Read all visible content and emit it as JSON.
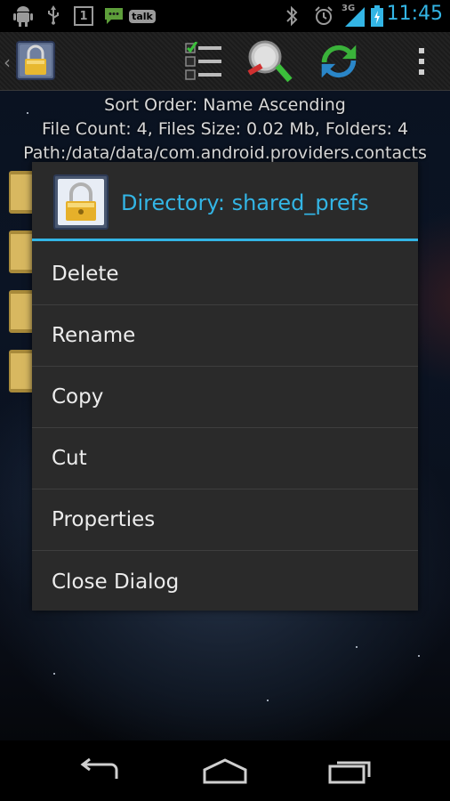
{
  "status_bar": {
    "time": "11:45",
    "network_label": "3G",
    "talk_label": "talk",
    "notification_count": "1",
    "icons": [
      "android-icon",
      "usb-icon",
      "notification-icon",
      "chat-icon",
      "talk-icon",
      "bluetooth-icon",
      "alarm-icon",
      "signal-icon",
      "battery-icon"
    ]
  },
  "toolbar": {
    "icons": [
      "app-lock-icon",
      "checklist-icon",
      "search-icon",
      "sync-icon",
      "overflow-menu-icon"
    ]
  },
  "info": {
    "sort_order": "Sort Order: Name Ascending",
    "file_count": "File Count: 4, Files Size: 0.02 Mb, Folders: 4",
    "path": "Path:/data/data/com.android.providers.contacts"
  },
  "dialog": {
    "title": "Directory: shared_prefs",
    "icon": "lock-icon",
    "items": [
      {
        "label": "Delete"
      },
      {
        "label": "Rename"
      },
      {
        "label": "Copy"
      },
      {
        "label": "Cut"
      },
      {
        "label": "Properties"
      },
      {
        "label": "Close Dialog"
      }
    ]
  },
  "nav": {
    "icons": [
      "back-icon",
      "home-icon",
      "recent-apps-icon"
    ]
  },
  "colors": {
    "accent": "#33b5e5",
    "dialog_bg": "#2a2a2a",
    "divider": "#3e3e3e"
  }
}
